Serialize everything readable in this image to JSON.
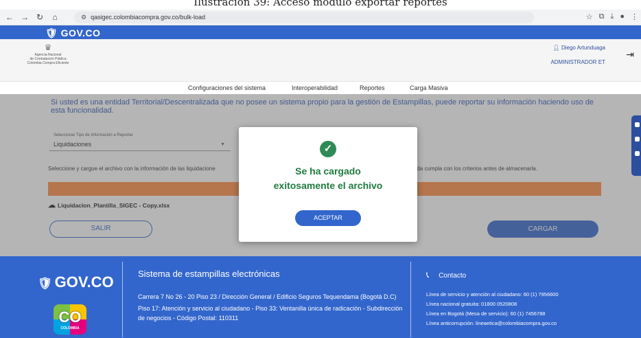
{
  "caption": "Ilustración 39: Acceso módulo exportar reportes",
  "browser": {
    "url": "qasigec.colombiacompra.gov.co/bulk-load"
  },
  "gov_logo": "GOV.CO",
  "agency": {
    "line1": "Agencia Nacional",
    "line2": "de Contratación Pública",
    "line3": "Colombia Compra Eficiente"
  },
  "user": {
    "name": "Diego Artunduaga",
    "role": "ADMINISTRADOR ET"
  },
  "nav": {
    "items": [
      "Configuraciones del sistema",
      "Interoperabilidad",
      "Reportes",
      "Carga Masiva"
    ]
  },
  "main": {
    "intro": "Si usted es una entidad Territorial/Descentralizada que no posee un sistema propio para la gestión de Estampillas, puede reportar su información haciendo uso de esta funcionalidad.",
    "select_label": "Seleccionar Tipo de Información a Reportar",
    "select_value": "Liquidaciones",
    "instruction_left": "Seleccione y cargue el archivo con la información de las liquidacione",
    "instruction_right": "rtada cumpla con los criterios antes de almacenarla.",
    "progress": 100,
    "file_name": "Liquidacion_Plantilla_SIGEC - Copy.xlsx",
    "exit_label": "SALIR",
    "upload_label": "CARGAR"
  },
  "modal": {
    "line1": "Se ha cargado",
    "line2": "exitosamente el archivo",
    "ok_label": "ACEPTAR"
  },
  "footer": {
    "logo": "GOV.CO",
    "colombia": "CO",
    "colombia_sub": "COLOMBIA",
    "title": "Sistema de estampillas electrónicas",
    "address": [
      "Carrera 7 No 26 - 20 Piso 23 / Dirección General / Edificio Seguros Tequendama (Bogotá D.C)",
      "Piso 17: Atención y servicio al ciudadano - Piso 33: Ventanilla única de radicación - Subdirección de negocios - Código Postal: 110311"
    ],
    "contact_title": "Contacto",
    "contact_lines": [
      "Línea de servicio y atención al ciudadano: 60 (1) 7956600",
      "Línea nacional gratuita: 01800 0520808",
      "Línea en Bogotá (Mesa de servicio): 60 (1) 7456788",
      "Línea anticorrupción: lineaetica@colombiacompra.gov.co"
    ]
  },
  "colors": {
    "primary": "#3366cc",
    "progress": "#ff8c42",
    "success": "#2e8b57",
    "success_text": "#1f7a3e"
  }
}
